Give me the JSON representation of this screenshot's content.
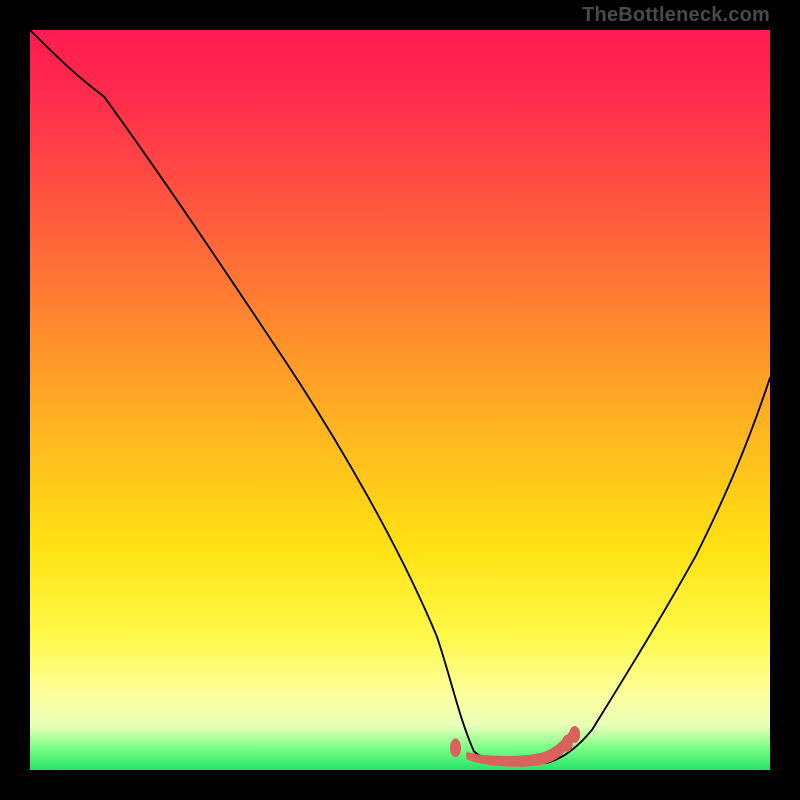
{
  "attribution": "TheBottleneck.com",
  "colors": {
    "background": "#000000",
    "curve_stroke": "#000000",
    "marker_stroke": "#d9635c",
    "gradient_stops": [
      "#ff1a52",
      "#ff5a3d",
      "#ffb820",
      "#fff94a",
      "#26e36a"
    ]
  },
  "chart_data": {
    "type": "line",
    "title": "",
    "xlabel": "",
    "ylabel": "",
    "xlim": [
      0,
      100
    ],
    "ylim": [
      0,
      100
    ],
    "series": [
      {
        "name": "bottleneck-curve",
        "x": [
          0,
          5,
          10,
          15,
          20,
          25,
          30,
          35,
          40,
          45,
          50,
          55,
          57,
          60,
          64,
          68,
          72,
          76,
          80,
          85,
          90,
          95,
          100
        ],
        "y": [
          100,
          96,
          91,
          84,
          77,
          69,
          61,
          53,
          44,
          35,
          26,
          15,
          8,
          2,
          0,
          0,
          0,
          2,
          8,
          17,
          28,
          40,
          53
        ]
      },
      {
        "name": "flat-minimum-markers",
        "x": [
          57.5,
          60,
          62,
          64,
          66,
          68,
          70,
          71.5,
          72.5,
          73.5
        ],
        "y": [
          3,
          1.5,
          0.8,
          0.5,
          0.5,
          0.5,
          1.2,
          2.2,
          3.2,
          4.2
        ]
      }
    ],
    "annotations": []
  }
}
